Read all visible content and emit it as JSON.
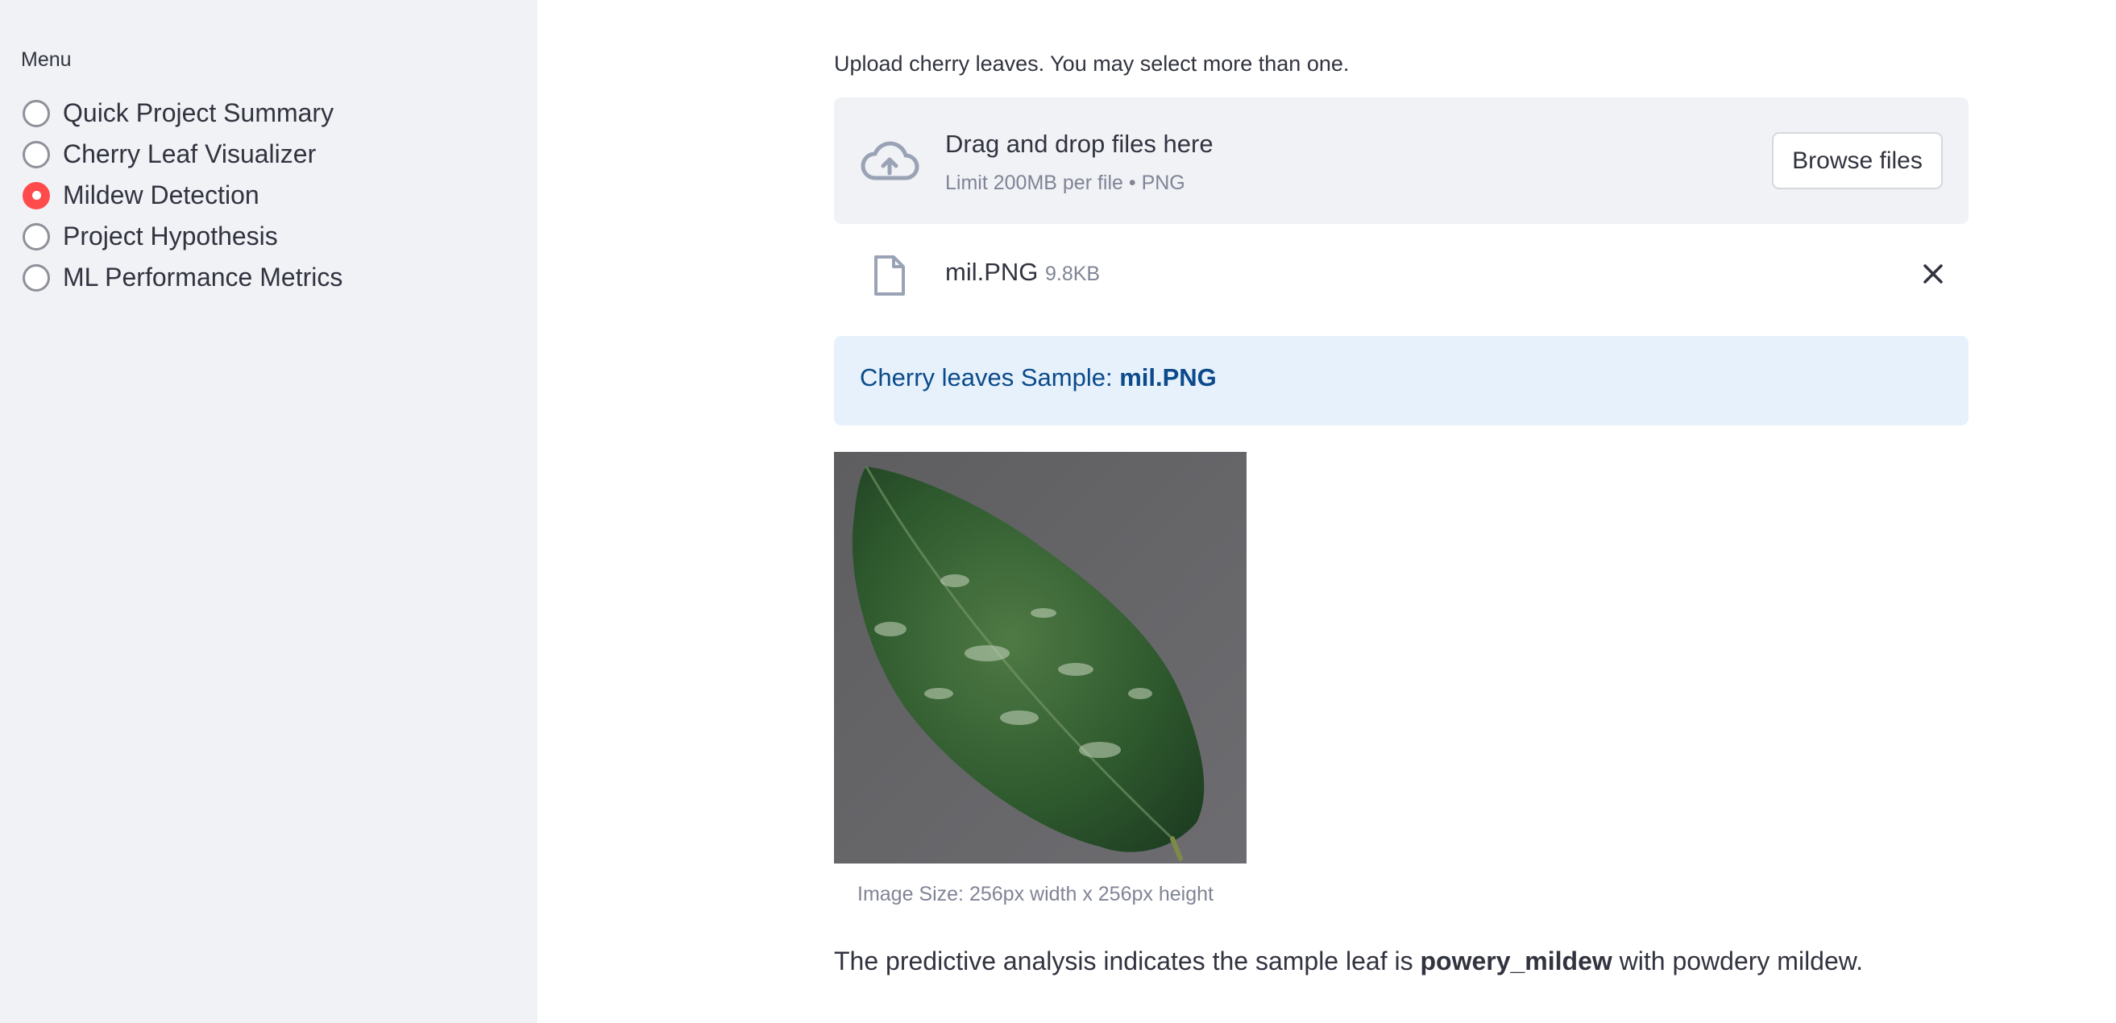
{
  "sidebar": {
    "menu_label": "Menu",
    "items": [
      {
        "label": "Quick Project Summary",
        "checked": false
      },
      {
        "label": "Cherry Leaf Visualizer",
        "checked": false
      },
      {
        "label": "Mildew Detection",
        "checked": true
      },
      {
        "label": "Project Hypothesis",
        "checked": false
      },
      {
        "label": "ML Performance Metrics",
        "checked": false
      }
    ]
  },
  "uploader": {
    "label": "Upload cherry leaves. You may select more than one.",
    "drop_title": "Drag and drop files here",
    "drop_limit": "Limit 200MB per file • PNG",
    "browse_label": "Browse files"
  },
  "file": {
    "name": "mil.PNG",
    "size": "9.8KB"
  },
  "info": {
    "prefix": "Cherry leaves Sample: ",
    "filename": "mil.PNG"
  },
  "image": {
    "caption": "Image Size: 256px width x 256px height"
  },
  "prediction": {
    "prefix": "The predictive analysis indicates the sample leaf is ",
    "result": "powery_mildew",
    "suffix": " with powdery mildew."
  },
  "colors": {
    "sidebar_bg": "#f0f2f6",
    "accent": "#ff4b4b",
    "info_bg": "#e6f1fb",
    "info_text": "#0b4a8b"
  }
}
